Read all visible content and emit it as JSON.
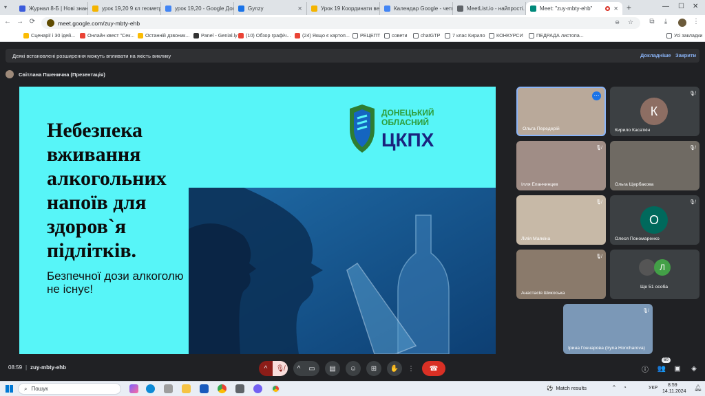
{
  "browser": {
    "tabs": [
      {
        "title": "Журнал 8-Б | Нові знання",
        "color": "#3b5bdb"
      },
      {
        "title": "урок 19,20 9 кл геометр.",
        "color": "#f4b400"
      },
      {
        "title": "урок 19,20 - Google Док",
        "color": "#4285f4"
      },
      {
        "title": "Gynzy",
        "color": "#1a73e8"
      },
      {
        "title": "Урок 19 Координати век",
        "color": "#f4b400"
      },
      {
        "title": "Календар Google - четв.",
        "color": "#4285f4"
      },
      {
        "title": "MeetList.io - найпрості.",
        "color": "#5f6368"
      },
      {
        "title": "Meet: \"zuy-mbty-ehb\"",
        "color": "#00897b"
      }
    ],
    "new_tab": "+",
    "url": "meet.google.com/zuy-mbty-ehb",
    "bookmarks": [
      {
        "label": "Сценарії і 30 ідей...",
        "color": "#fbbc04"
      },
      {
        "label": "Онлайн квест \"Сек...",
        "color": "#ea4335"
      },
      {
        "label": "Останній дзвоник...",
        "color": "#fbbc04"
      },
      {
        "label": "Panel - Genial.ly",
        "color": "#333333"
      },
      {
        "label": "(10) Обзор графіч...",
        "color": "#ea4335"
      },
      {
        "label": "(24) Якщо є картоп...",
        "color": "#ea4335"
      },
      {
        "label": "РЕЦЕПТ",
        "color": "#5f6368"
      },
      {
        "label": "совети",
        "color": "#5f6368"
      },
      {
        "label": "chatGTP",
        "color": "#5f6368"
      },
      {
        "label": "7 клас Кирило",
        "color": "#5f6368"
      },
      {
        "label": "КОНКУРСИ",
        "color": "#5f6368"
      },
      {
        "label": "ПЕДРАДА листопа...",
        "color": "#5f6368"
      }
    ],
    "all_bookmarks": "Усі закладки"
  },
  "meet": {
    "notice": {
      "text": "Деякі встановлені розширення можуть впливати на якість виклику",
      "details": "Докладніше",
      "close": "Закрити"
    },
    "presenter": "Світлана Пшенична (Презентація)",
    "slide": {
      "title": "Небезпека вживання алкогольних напоїв для здоров`я підлітків.",
      "subtitle": "Безпечної дози алкоголю не існує!",
      "logo_line1": "ДОНЕЦЬКИЙ",
      "logo_line2": "ОБЛАСНИЙ",
      "logo_main": "ЦКПХ"
    },
    "participants": [
      {
        "name": "Ольга Передерій",
        "type": "video"
      },
      {
        "name": "Кирило Касаткін",
        "type": "avatar",
        "initial": "К",
        "color": "#8d6e63"
      },
      {
        "name": "Ілля Епанчинцев",
        "type": "video"
      },
      {
        "name": "Ольга Щербакова",
        "type": "video"
      },
      {
        "name": "Лілія Маякіна",
        "type": "video"
      },
      {
        "name": "Олеся Пономаренко",
        "type": "avatar",
        "initial": "О",
        "color": "#00695c"
      },
      {
        "name": "Анастасія Шикоська",
        "type": "video"
      },
      {
        "name": "Ще 51 особа",
        "type": "more",
        "initial": "Л",
        "color": "#43a047"
      },
      {
        "name": "Ірина Гончарова (Iryna Honcharova)",
        "type": "video"
      }
    ],
    "time": "08:59",
    "code": "zuy-mbty-ehb",
    "participant_count": "60"
  },
  "taskbar": {
    "search": "Пошук",
    "match": "Match results",
    "lang": "УКР",
    "clock_time": "8:59",
    "clock_date": "14.11.2024"
  }
}
